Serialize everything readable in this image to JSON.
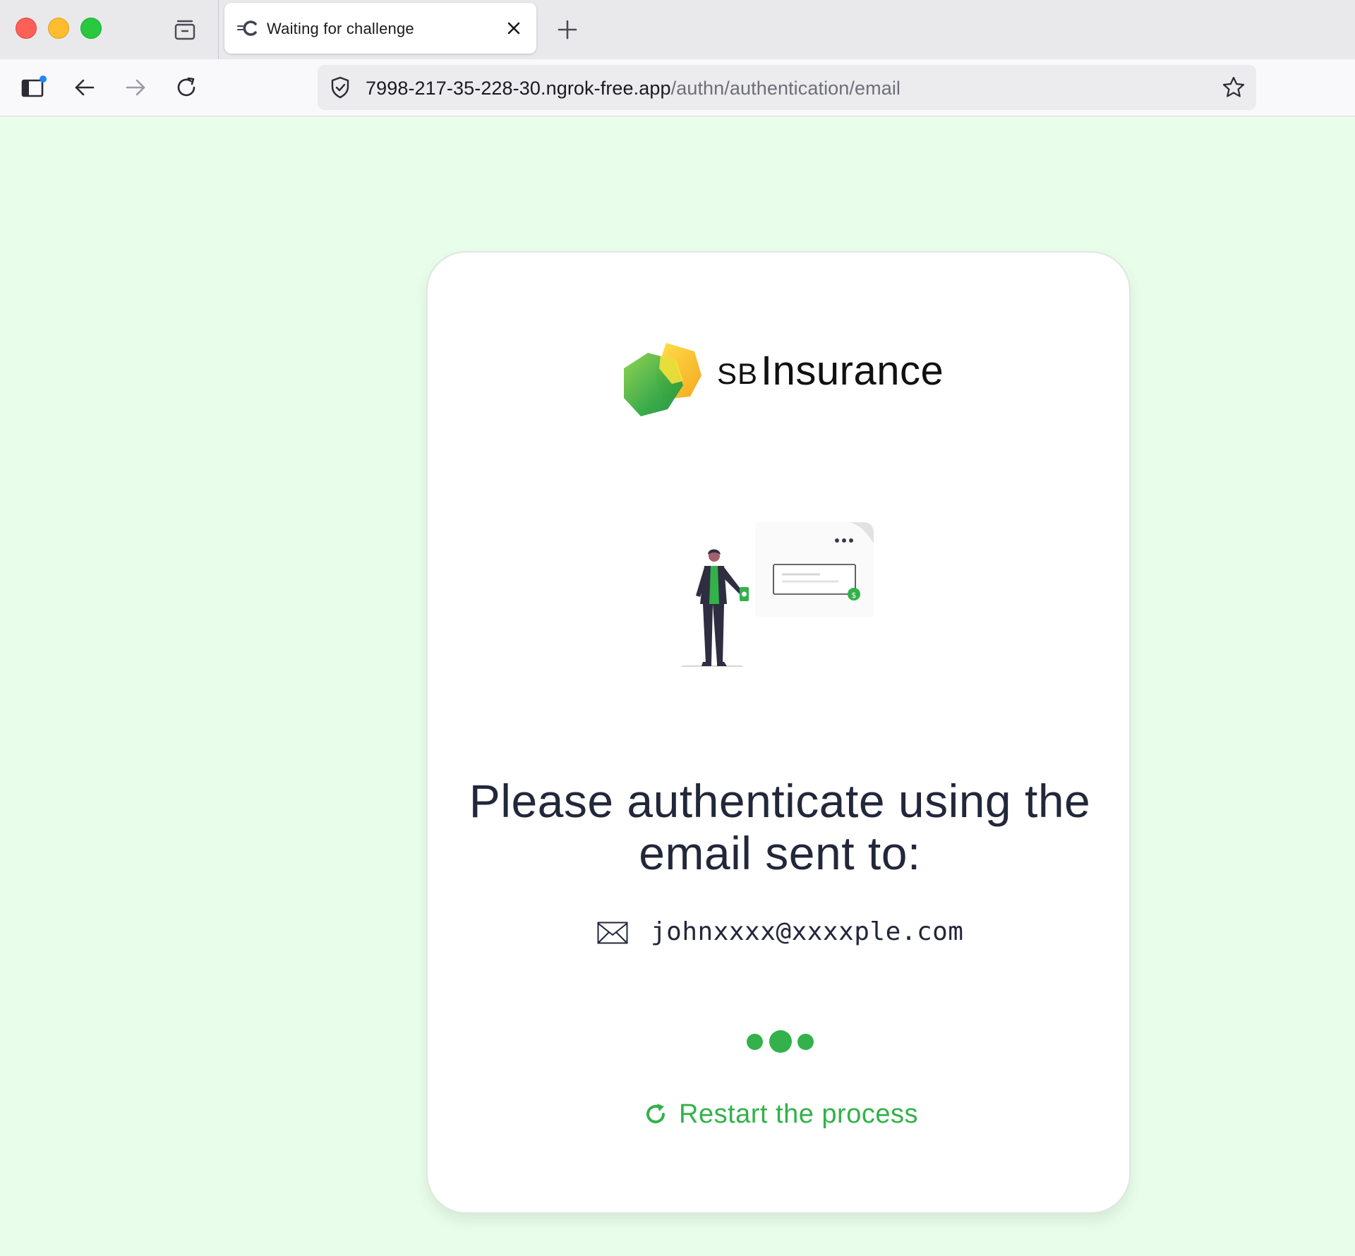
{
  "browser": {
    "tab": {
      "title": "Waiting for challenge"
    },
    "url": {
      "host": "7998-217-35-228-30.ngrok-free.app",
      "path": "/authn/authentication/email"
    }
  },
  "colors": {
    "accent": "#33b14a",
    "page_bg": "#e9fdeb",
    "text_dark": "#22273a"
  },
  "brand": {
    "prefix": "SB",
    "name": "Insurance"
  },
  "auth": {
    "heading": "Please authenticate using the email sent to:",
    "email": "johnxxxx@xxxxple.com",
    "restart_label": "Restart the process"
  },
  "icons": {
    "tab_favicon": "ngrok-icon",
    "close": "close-icon",
    "new_tab": "plus-icon",
    "sidebar": "sidebar-icon",
    "back": "arrow-left-icon",
    "forward": "arrow-right-icon",
    "reload": "reload-icon",
    "security": "shield-icon",
    "bookmark": "star-icon",
    "mail": "mail-icon",
    "restart": "refresh-icon"
  }
}
